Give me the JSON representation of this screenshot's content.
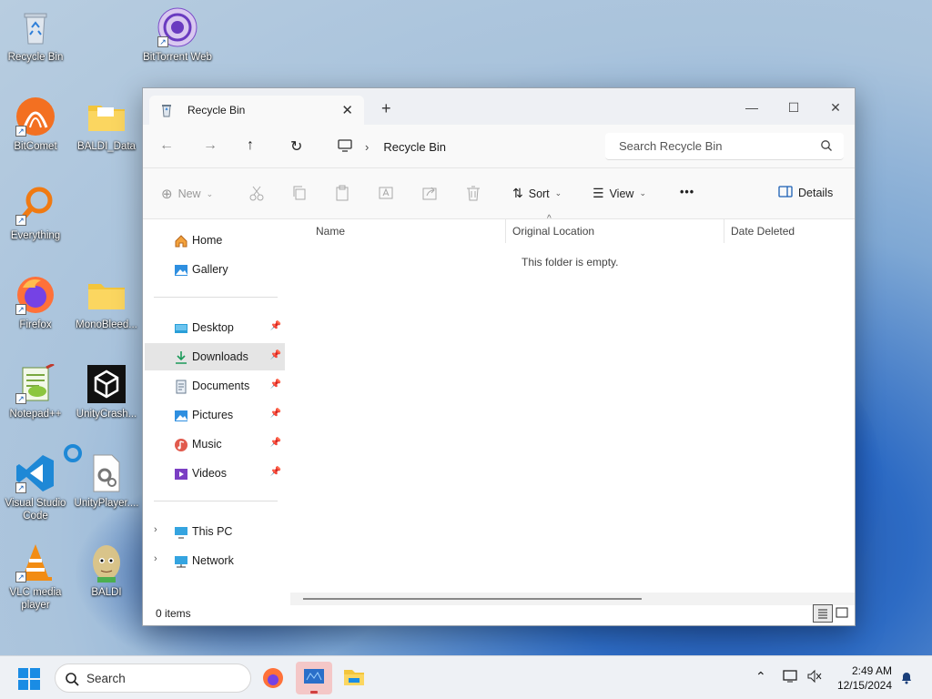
{
  "desktop": {
    "icons": [
      {
        "label": "Recycle Bin"
      },
      {
        "label": "BitTorrent Web"
      },
      {
        "label": "BitComet"
      },
      {
        "label": "BALDI_Data"
      },
      {
        "label": "Everything"
      },
      {
        "label": "Firefox"
      },
      {
        "label": "MonoBleed..."
      },
      {
        "label": "Notepad++"
      },
      {
        "label": "UnityCrash..."
      },
      {
        "label": "Visual Studio Code"
      },
      {
        "label": "UnityPlayer...."
      },
      {
        "label": "VLC media player"
      },
      {
        "label": "BALDI"
      }
    ]
  },
  "explorer": {
    "tab_title": "Recycle Bin",
    "breadcrumb": "Recycle Bin",
    "search_placeholder": "Search Recycle Bin",
    "commands": {
      "new": "New",
      "sort": "Sort",
      "view": "View",
      "more": "•••",
      "details": "Details"
    },
    "nav": {
      "home": "Home",
      "gallery": "Gallery",
      "desktop": "Desktop",
      "downloads": "Downloads",
      "documents": "Documents",
      "pictures": "Pictures",
      "music": "Music",
      "videos": "Videos",
      "this_pc": "This PC",
      "network": "Network"
    },
    "columns": {
      "name": "Name",
      "original_location": "Original Location",
      "date_deleted": "Date Deleted"
    },
    "empty_message": "This folder is empty.",
    "status_count": "0 items"
  },
  "taskbar": {
    "search_label": "Search",
    "time": "2:49 AM",
    "date": "12/15/2024"
  },
  "colors": {
    "accent": "#0067c0",
    "selection": "#e5e5e5"
  }
}
